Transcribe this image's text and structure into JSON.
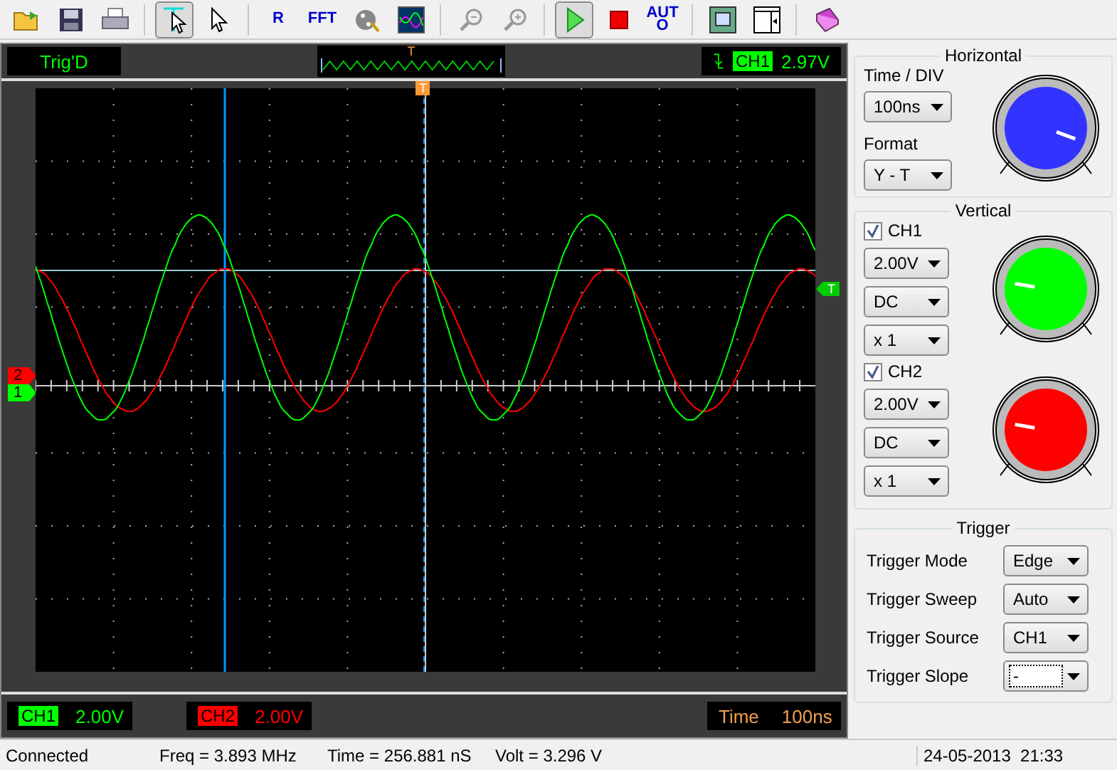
{
  "toolbar": [
    {
      "items": [
        {
          "selected": false
        },
        {
          "selected": false
        },
        {
          "selected": false
        }
      ]
    },
    {
      "items": [
        {
          "selected": true
        },
        {
          "selected": false
        }
      ]
    },
    {
      "items": [
        {
          "label": "R",
          "selected": false
        },
        {
          "label": "FFT",
          "selected": false
        },
        {
          "selected": false
        },
        {
          "selected": false
        }
      ]
    },
    {
      "items": [
        {
          "selected": false
        },
        {
          "selected": false
        }
      ]
    },
    {
      "items": [
        {
          "selected": true
        },
        {
          "selected": false
        },
        {
          "label": "AUTO",
          "selected": false
        }
      ]
    },
    {
      "items": [
        {
          "selected": false
        },
        {
          "selected": false
        }
      ]
    },
    {
      "items": [
        {
          "selected": false
        }
      ]
    }
  ],
  "status_top": {
    "state": "Trig'D",
    "marker": "T",
    "trigger_channel": "CH1",
    "trigger_level": "2.97V"
  },
  "screen": {
    "channel_markers": [
      {
        "label": "2",
        "color": "#ff0000"
      },
      {
        "label": "1",
        "color": "#00ff00"
      }
    ],
    "trigger_marker": "T",
    "time_marker": "T"
  },
  "channel_readouts": [
    {
      "name": "CH1",
      "value": "2.00V",
      "color": "#00ff00"
    },
    {
      "name": "CH2",
      "value": "2.00V",
      "color": "#ff0000"
    }
  ],
  "time_readout": {
    "label": "Time",
    "value": "100ns"
  },
  "horizontal": {
    "title": "Horizontal",
    "time_label": "Time / DIV",
    "time_value": "100ns",
    "format_label": "Format",
    "format_value": "Y - T"
  },
  "vertical": {
    "title": "Vertical",
    "channels": [
      {
        "name": "CH1",
        "checked": true,
        "volts": "2.00V",
        "coupling": "DC",
        "probe": "x 1",
        "color": "#00ff00"
      },
      {
        "name": "CH2",
        "checked": true,
        "volts": "2.00V",
        "coupling": "DC",
        "probe": "x 1",
        "color": "#ff0000"
      }
    ]
  },
  "trigger": {
    "title": "Trigger",
    "rows": [
      {
        "label": "Trigger Mode",
        "value": "Edge",
        "focused": false
      },
      {
        "label": "Trigger Sweep",
        "value": "Auto",
        "focused": false
      },
      {
        "label": "Trigger Source",
        "value": "CH1",
        "focused": false
      },
      {
        "label": "Trigger Slope",
        "value": "-",
        "focused": true
      }
    ]
  },
  "status_bar": {
    "connection": "Connected",
    "freq": "Freq = 3.893 MHz",
    "time": "Time = 256.881 nS",
    "volt": "Volt = 3.296 V",
    "datetime": "24-05-2013  21:33"
  }
}
